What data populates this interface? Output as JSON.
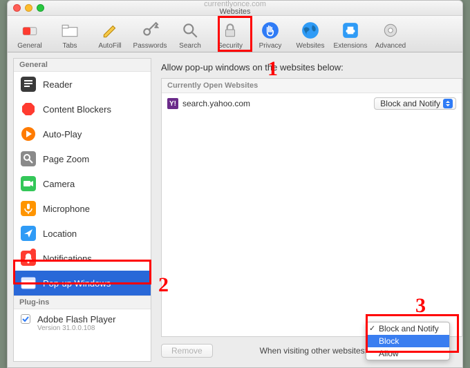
{
  "titlebar": {
    "subtitle_muted": "currentlyonce.com",
    "title": "Websites"
  },
  "toolbar": [
    {
      "id": "general",
      "label": "General"
    },
    {
      "id": "tabs",
      "label": "Tabs"
    },
    {
      "id": "autofill",
      "label": "AutoFill"
    },
    {
      "id": "passwords",
      "label": "Passwords"
    },
    {
      "id": "search",
      "label": "Search"
    },
    {
      "id": "security",
      "label": "Security"
    },
    {
      "id": "privacy",
      "label": "Privacy"
    },
    {
      "id": "websites",
      "label": "Websites"
    },
    {
      "id": "extensions",
      "label": "Extensions"
    },
    {
      "id": "advanced",
      "label": "Advanced"
    }
  ],
  "sidebar": {
    "section_general": "General",
    "items": [
      {
        "label": "Reader"
      },
      {
        "label": "Content Blockers"
      },
      {
        "label": "Auto-Play"
      },
      {
        "label": "Page Zoom"
      },
      {
        "label": "Camera"
      },
      {
        "label": "Microphone"
      },
      {
        "label": "Location"
      },
      {
        "label": "Notifications"
      },
      {
        "label": "Pop-up Windows"
      }
    ],
    "section_plugins": "Plug-ins",
    "plugin": {
      "label": "Adobe Flash Player",
      "version": "Version 31.0.0.108"
    }
  },
  "main": {
    "heading": "Allow pop-up windows on the websites below:",
    "panel_header": "Currently Open Websites",
    "rows": [
      {
        "site": "search.yahoo.com",
        "setting": "Block and Notify"
      }
    ],
    "remove_label": "Remove",
    "other_label": "When visiting other websites:",
    "dropdown": {
      "options": [
        "Block and Notify",
        "Block",
        "Allow"
      ],
      "checked": "Block and Notify",
      "hovered": "Block"
    }
  },
  "annotations": {
    "n1": "1",
    "n2": "2",
    "n3": "3"
  }
}
